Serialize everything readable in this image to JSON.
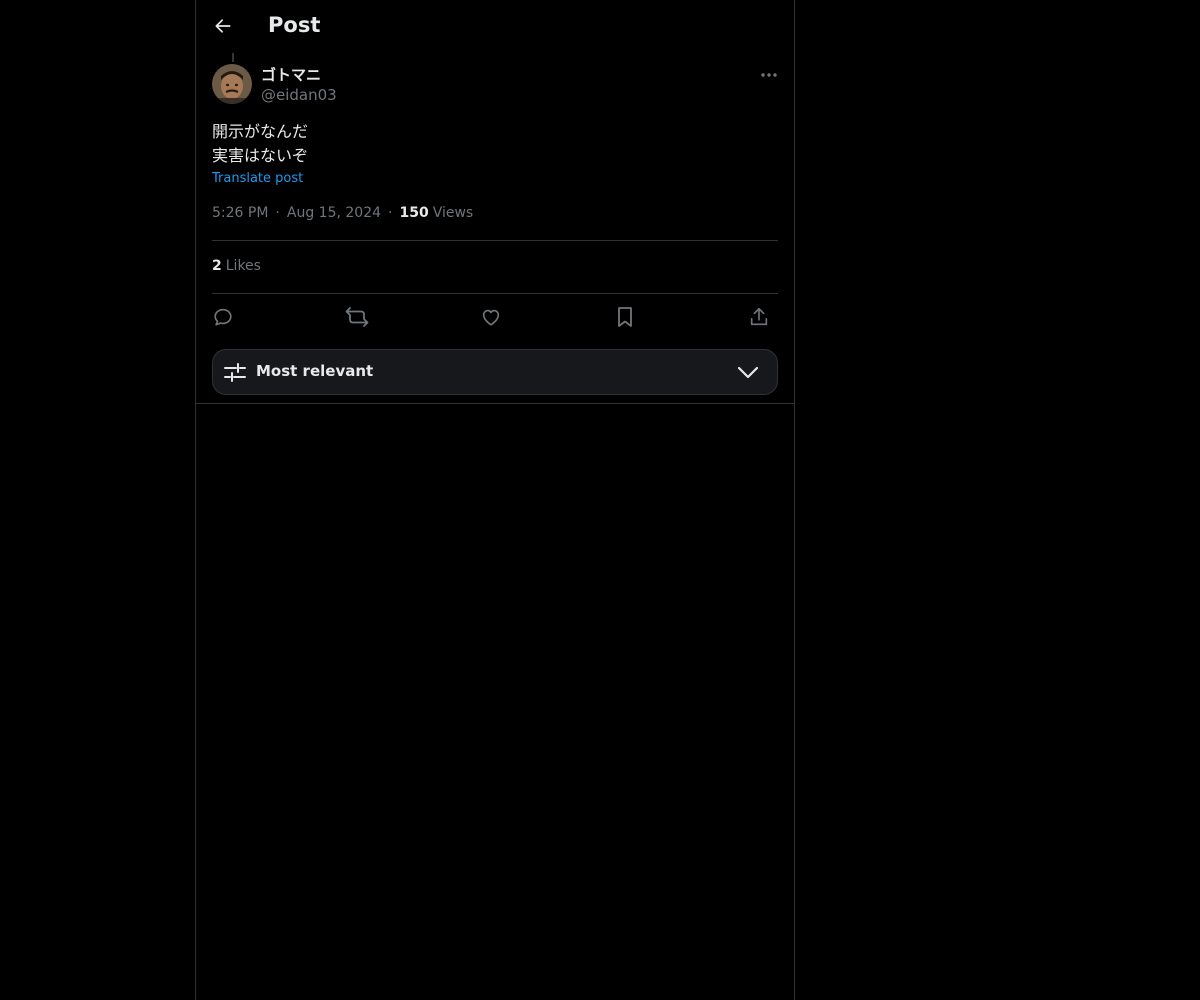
{
  "header": {
    "title": "Post"
  },
  "post": {
    "display_name": "ゴトマニ",
    "handle": "@eidan03",
    "text_lines": [
      "開示がなんだ",
      "実害はないぞ"
    ],
    "translate_label": "Translate post",
    "time": "5:26 PM",
    "date": "Aug 15, 2024",
    "views_count": "150",
    "views_label": "Views",
    "likes_count": "2",
    "likes_label": "Likes"
  },
  "sort": {
    "label": "Most relevant"
  },
  "colors": {
    "background": "#000000",
    "accent": "#1d9bf0",
    "secondary_text": "#71767b",
    "border": "#2f3336"
  },
  "icons": {
    "back": "arrow-left-icon",
    "more": "more-horizontal-icon",
    "reply": "reply-icon",
    "repost": "repost-icon",
    "like": "heart-icon",
    "bookmark": "bookmark-icon",
    "share": "share-icon",
    "sort": "sliders-icon",
    "chevron": "chevron-down-icon"
  }
}
